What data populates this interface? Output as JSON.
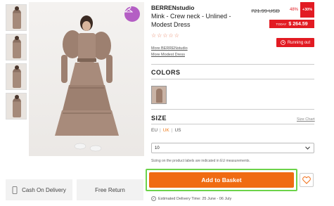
{
  "product": {
    "brand": "BERRENstudio",
    "title": "Mink - Crew neck - Unlined - Modest Dress",
    "rating_stars": "☆☆☆☆☆",
    "more_brand_link": "More BERRENstudio",
    "more_dress_link": "More Modest Dress"
  },
  "pricing": {
    "old_price": "721.99 USD",
    "discount_pct": "48%",
    "discount_badge": "+30%",
    "today_label": "TODAY",
    "today_price": "$ 264.59",
    "running_out": "Running out"
  },
  "colors": {
    "title": "COLORS"
  },
  "size": {
    "title": "SIZE",
    "size_chart_link": "Size Chart",
    "systems": [
      "EU",
      "UK",
      "US"
    ],
    "active_system": "UK",
    "selected_value": "10",
    "note": "Sizing on the product labels are indicated in EU measurements."
  },
  "actions": {
    "add_to_basket": "Add to Basket",
    "cash_on_delivery": "Cash On Delivery",
    "free_return": "Free Return"
  },
  "delivery": {
    "text": "Estimated Delivery Time: 25 June - 06 July"
  },
  "colors_palette": {
    "accent_orange": "#f06b12",
    "sale_red": "#e21b23",
    "highlight_green": "#6cd34a",
    "collection_purple": "#b45ec4"
  }
}
